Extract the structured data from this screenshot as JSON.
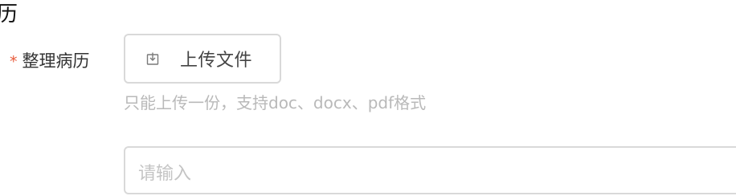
{
  "section": {
    "title_fragment": "历"
  },
  "form": {
    "medical_record": {
      "required_mark": "*",
      "label": "整理病历",
      "upload_button_label": "上传文件",
      "upload_icon": "download-icon",
      "hint": "只能上传一份，支持doc、docx、pdf格式"
    },
    "notes": {
      "placeholder": "请输入"
    }
  },
  "colors": {
    "required": "#e85a3a",
    "border": "#d9d9d9",
    "hint": "#b9b9b9"
  }
}
